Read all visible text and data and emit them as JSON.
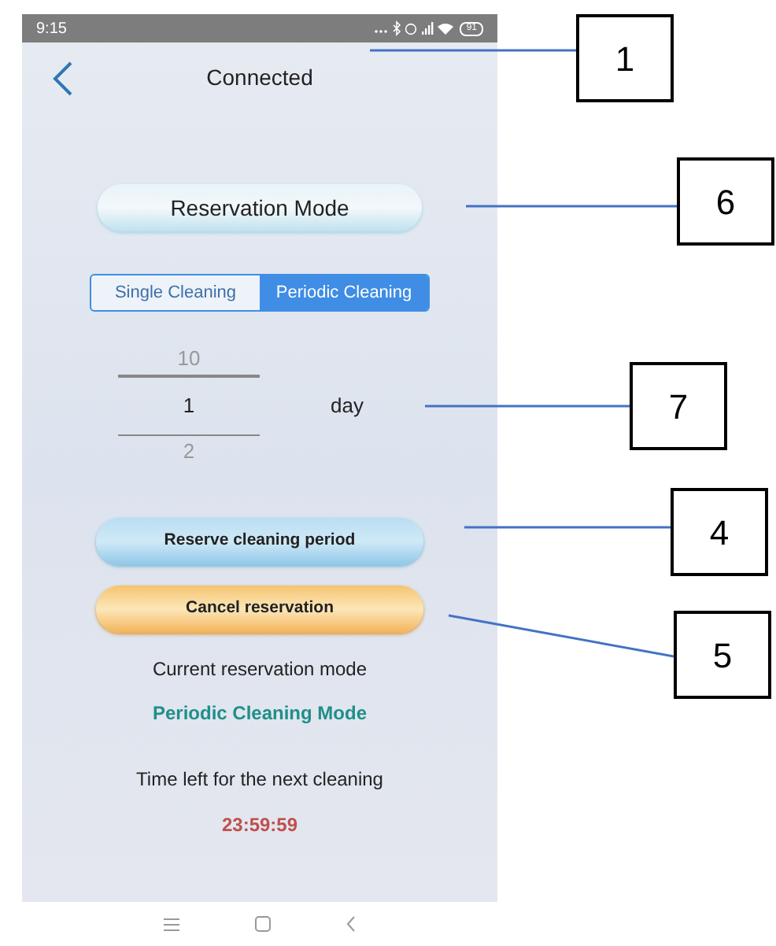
{
  "status_bar": {
    "time": "9:15",
    "battery": "91"
  },
  "header": {
    "title": "Connected"
  },
  "reservation_mode_button": {
    "label": "Reservation Mode"
  },
  "mode_tabs": [
    {
      "label": "Single Cleaning",
      "selected": false
    },
    {
      "label": "Periodic Cleaning",
      "selected": true
    }
  ],
  "day_picker": {
    "above": "10",
    "value": "1",
    "below": "2",
    "unit": "day"
  },
  "buttons": [
    {
      "label": "Reserve cleaning period",
      "kind": "blue"
    },
    {
      "label": "Cancel reservation",
      "kind": "orange"
    }
  ],
  "current_mode": {
    "label": "Current reservation mode",
    "value": "Periodic Cleaning Mode"
  },
  "time_left": {
    "label": "Time left for the next cleaning",
    "value": "23:59:59"
  },
  "callouts": [
    {
      "label": "1"
    },
    {
      "label": "6"
    },
    {
      "label": "7"
    },
    {
      "label": "4"
    },
    {
      "label": "5"
    }
  ]
}
